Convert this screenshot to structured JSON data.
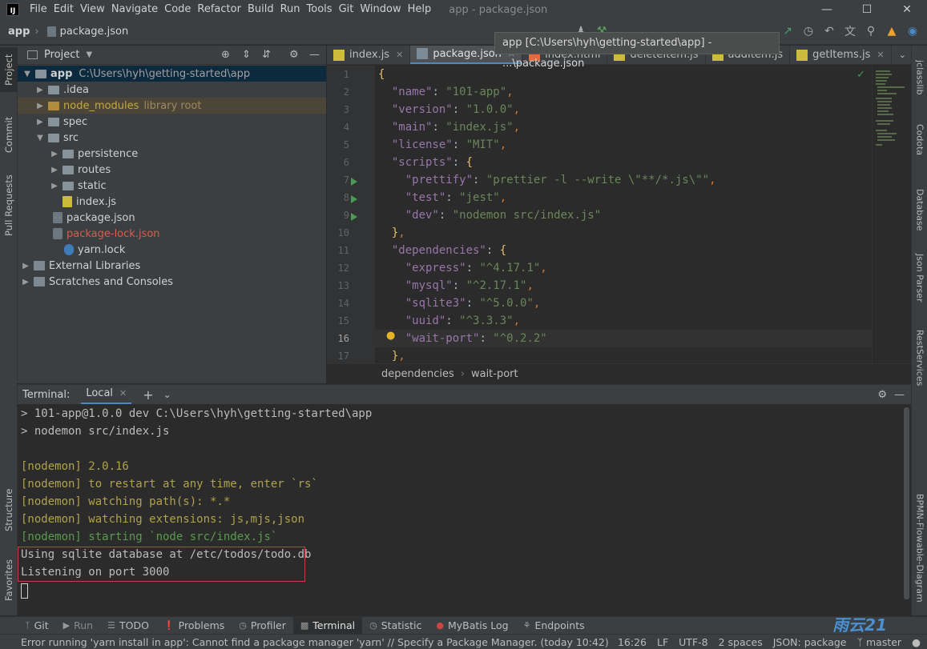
{
  "titlebar": {
    "menus": [
      "File",
      "Edit",
      "View",
      "Navigate",
      "Code",
      "Refactor",
      "Build",
      "Run",
      "Tools",
      "Git",
      "Window",
      "Help"
    ],
    "title": "app - package.json"
  },
  "navbar": {
    "project": "app",
    "file": "package.json"
  },
  "tooltip": "app [C:\\Users\\hyh\\getting-started\\app] - ...\\package.json",
  "left_strip": {
    "tabs": [
      "Project",
      "Commit",
      "Pull Requests",
      "Structure",
      "Favorites"
    ]
  },
  "right_strip": {
    "tabs": [
      "jclasslib",
      "Codota",
      "Database",
      "Json Parser",
      "RestServices",
      "BPMN-Flowable-Diagram"
    ]
  },
  "project_panel": {
    "title": "Project",
    "root": {
      "name": "app",
      "path": "C:\\Users\\hyh\\getting-started\\app"
    },
    "items": [
      {
        "label": ".idea"
      },
      {
        "label": "node_modules",
        "extra": "library root"
      },
      {
        "label": "spec"
      },
      {
        "label": "src"
      },
      {
        "label": "persistence"
      },
      {
        "label": "routes"
      },
      {
        "label": "static"
      },
      {
        "label": "index.js"
      },
      {
        "label": "package.json"
      },
      {
        "label": "package-lock.json"
      },
      {
        "label": "yarn.lock"
      },
      {
        "label": "External Libraries"
      },
      {
        "label": "Scratches and Consoles"
      }
    ]
  },
  "editor": {
    "tabs": [
      "index.js",
      "package.json",
      "index.html",
      "deleteItem.js",
      "addItem.js",
      "getItems.js"
    ],
    "line_numbers": [
      "1",
      "2",
      "3",
      "4",
      "5",
      "6",
      "7",
      "8",
      "9",
      "10",
      "11",
      "12",
      "13",
      "14",
      "15",
      "16",
      "17"
    ],
    "breadcrumbs": [
      "dependencies",
      "wait-port"
    ]
  },
  "terminal": {
    "label": "Terminal:",
    "tab": "Local",
    "lines": [
      "> 101-app@1.0.0 dev C:\\Users\\hyh\\getting-started\\app",
      "> nodemon src/index.js",
      "",
      "[nodemon] 2.0.16",
      "[nodemon] to restart at any time, enter `rs`",
      "[nodemon] watching path(s): *.*",
      "[nodemon] watching extensions: js,mjs,json",
      "[nodemon] starting `node src/index.js`",
      "Using sqlite database at /etc/todos/todo.db",
      "Listening on port 3000"
    ]
  },
  "bottom_tools": [
    "Git",
    "Run",
    "TODO",
    "Problems",
    "Profiler",
    "Terminal",
    "Statistic",
    "MyBatis Log",
    "Endpoints"
  ],
  "status": {
    "message": "Error running 'yarn install in app': Cannot find a package manager 'yarn' // Specify a Package Manager. (today 10:42)",
    "position": "16:26",
    "line_sep": "LF",
    "encoding": "UTF-8",
    "indent": "2 spaces",
    "schema": "JSON: package",
    "branch": "master"
  }
}
